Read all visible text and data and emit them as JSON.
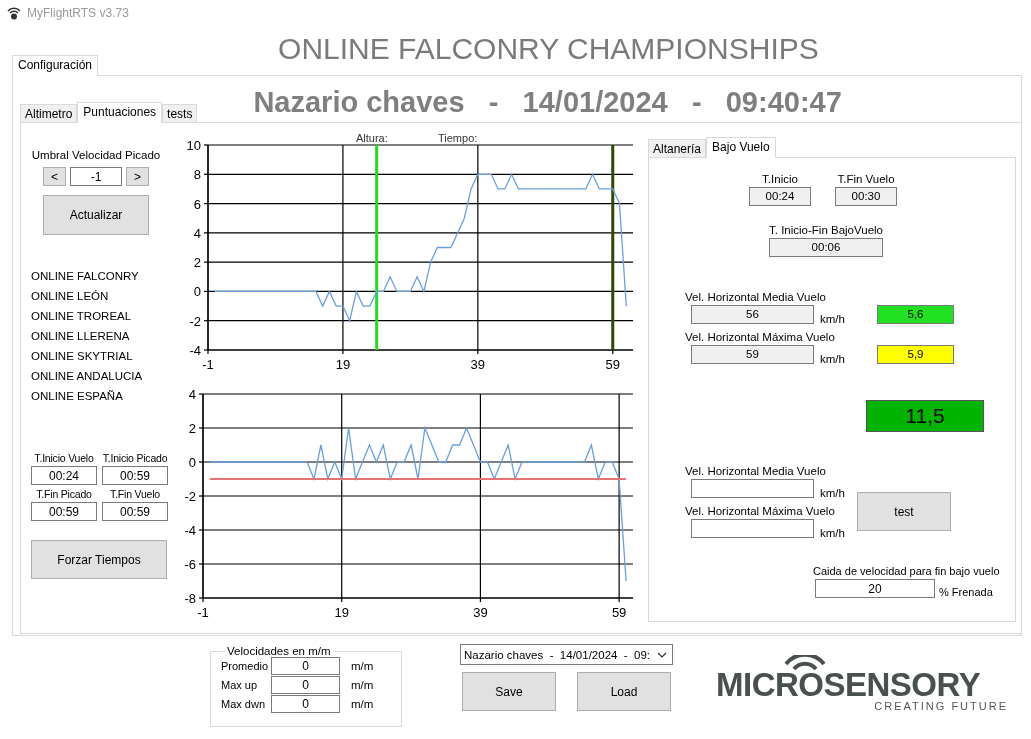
{
  "window": {
    "title": "MyFlightRTS v3.73"
  },
  "headline": "ONLINE FALCONRY CHAMPIONSHIPS",
  "main_tabs": [
    {
      "label": "Configuración",
      "selected": true
    }
  ],
  "session_title": "Nazario chaves   -   14/01/2024   -   09:40:47",
  "sub_tabs": [
    {
      "label": "Altimetro",
      "selected": false
    },
    {
      "label": "Puntuaciones",
      "selected": true
    },
    {
      "label": "tests",
      "selected": false
    }
  ],
  "threshold": {
    "label": "Umbral Velocidad Picado",
    "decrement": "<",
    "value": "-1",
    "increment": ">"
  },
  "update_button": "Actualizar",
  "competitions": [
    "ONLINE FALCONRY",
    "ONLINE LEÓN",
    "ONLINE TROREAL",
    "ONLINE LLERENA",
    "ONLINE SKYTRIAL",
    "ONLINE ANDALUCIA",
    "ONLINE ESPAÑA"
  ],
  "times": [
    {
      "label": "T.Inicio Vuelo",
      "value": "00:24"
    },
    {
      "label": "T.Inicio Picado",
      "value": "00:59"
    },
    {
      "label": "T.Fin Picado",
      "value": "00:59"
    },
    {
      "label": "T.Fin Vuelo",
      "value": "00:59"
    }
  ],
  "force_button": "Forzar Tiempos",
  "altitude_chart": {
    "readouts": [
      "Altura:",
      "Tiempo:"
    ],
    "chart_data": {
      "type": "line",
      "x": [
        0,
        1,
        2,
        3,
        4,
        5,
        6,
        7,
        8,
        9,
        10,
        11,
        12,
        13,
        14,
        15,
        16,
        17,
        18,
        19,
        20,
        21,
        22,
        23,
        24,
        25,
        26,
        27,
        28,
        29,
        30,
        31,
        32,
        33,
        34,
        35,
        36,
        37,
        38,
        39,
        40,
        41,
        42,
        43,
        44,
        45,
        46,
        47,
        48,
        49,
        50,
        51,
        52,
        53,
        54,
        55,
        56,
        57,
        58,
        59,
        60,
        61
      ],
      "series": [
        {
          "color": "#6a9fe0",
          "values": [
            0,
            0,
            0,
            0,
            0,
            0,
            0,
            0,
            0,
            0,
            0,
            0,
            0,
            0,
            0,
            0,
            -1,
            0,
            -1,
            -1,
            -2,
            0,
            -1,
            -1,
            0,
            0,
            1,
            0,
            0,
            0,
            1,
            0,
            2,
            3,
            3,
            3,
            4,
            5,
            7,
            8,
            8,
            8,
            7,
            7,
            8,
            7,
            7,
            7,
            7,
            7,
            7,
            7,
            7,
            7,
            7,
            7,
            8,
            7,
            7,
            7,
            6,
            -1
          ]
        }
      ],
      "xlim": [
        -1,
        62
      ],
      "ylim": [
        -4,
        10
      ],
      "xticks": [
        -1,
        19,
        39,
        59
      ],
      "yticks": [
        -4,
        -2,
        0,
        2,
        4,
        6,
        8,
        10
      ],
      "grid": true,
      "ref_lines": [
        {
          "axis": "x",
          "value": 24,
          "color": "#1ee01e"
        },
        {
          "axis": "x",
          "value": 59,
          "color": "#2e4a00"
        }
      ]
    }
  },
  "speed_chart": {
    "chart_data": {
      "type": "line",
      "x": [
        0,
        1,
        2,
        3,
        4,
        5,
        6,
        7,
        8,
        9,
        10,
        11,
        12,
        13,
        14,
        15,
        16,
        17,
        18,
        19,
        20,
        21,
        22,
        23,
        24,
        25,
        26,
        27,
        28,
        29,
        30,
        31,
        32,
        33,
        34,
        35,
        36,
        37,
        38,
        39,
        40,
        41,
        42,
        43,
        44,
        45,
        46,
        47,
        48,
        49,
        50,
        51,
        52,
        53,
        54,
        55,
        56,
        57,
        58,
        59,
        60
      ],
      "series": [
        {
          "color": "#6a9fe0",
          "values": [
            0,
            0,
            0,
            0,
            0,
            0,
            0,
            0,
            0,
            0,
            0,
            0,
            0,
            0,
            0,
            -1,
            1,
            -1,
            0,
            -1,
            2,
            -1,
            0,
            1,
            0,
            1,
            -1,
            0,
            0,
            1,
            -1,
            2,
            1,
            0,
            0,
            1,
            1,
            2,
            1,
            0,
            0,
            -1,
            0,
            1,
            -1,
            0,
            0,
            0,
            0,
            0,
            0,
            0,
            0,
            0,
            0,
            1,
            -1,
            0,
            0,
            -1,
            -7
          ]
        },
        {
          "color": "#e57373",
          "values": [
            -1,
            -1,
            -1,
            -1,
            -1,
            -1,
            -1,
            -1,
            -1,
            -1,
            -1,
            -1,
            -1,
            -1,
            -1,
            -1,
            -1,
            -1,
            -1,
            -1,
            -1,
            -1,
            -1,
            -1,
            -1,
            -1,
            -1,
            -1,
            -1,
            -1,
            -1,
            -1,
            -1,
            -1,
            -1,
            -1,
            -1,
            -1,
            -1,
            -1,
            -1,
            -1,
            -1,
            -1,
            -1,
            -1,
            -1,
            -1,
            -1,
            -1,
            -1,
            -1,
            -1,
            -1,
            -1,
            -1,
            -1,
            -1,
            -1,
            -1,
            -1
          ]
        }
      ],
      "grid": true,
      "xlim": [
        -1,
        61
      ],
      "ylim": [
        -8,
        4
      ],
      "xticks": [
        -1,
        19,
        39,
        59
      ],
      "yticks": [
        -8,
        -6,
        -4,
        -2,
        0,
        2,
        4
      ]
    }
  },
  "score_tabs": [
    {
      "label": "Altanería",
      "selected": false
    },
    {
      "label": "Bajo Vuelo",
      "selected": true
    }
  ],
  "low_flight": {
    "start": {
      "label": "T.Inicio",
      "value": "00:24"
    },
    "end": {
      "label": "T.Fin Vuelo",
      "value": "00:30"
    },
    "duration": {
      "label": "T. Inicio-Fin BajoVuelo",
      "value": "00:06"
    },
    "speeds": [
      {
        "label": "Vel. Horizontal Media Vuelo",
        "value": "56",
        "unit": "km/h",
        "score": "5,6",
        "color": "#21e021"
      },
      {
        "label": "Vel. Horizontal Máxima Vuelo",
        "value": "59",
        "unit": "km/h",
        "score": "5,9",
        "color": "#ffff00"
      }
    ],
    "total": {
      "value": "11,5",
      "color": "#00b400"
    },
    "test_inputs": [
      {
        "label": "Vel. Horizontal Media Vuelo",
        "unit": "km/h"
      },
      {
        "label": "Vel. Horizontal Máxima Vuelo",
        "unit": "km/h"
      }
    ],
    "test_button": "test",
    "drop": {
      "label": "Caida de velocidad para fin bajo vuelo",
      "value": "20",
      "unit": "% Frenada"
    }
  },
  "velocities": {
    "title": "Velocidades en m/m",
    "rows": [
      {
        "label": "Promedio",
        "value": "0",
        "unit": "m/m"
      },
      {
        "label": "Max up",
        "value": "0",
        "unit": "m/m"
      },
      {
        "label": "Max dwn",
        "value": "0",
        "unit": "m/m"
      }
    ]
  },
  "session_select": {
    "value": "Nazario chaves  -  14/01/2024  -  09:"
  },
  "buttons": [
    "Save",
    "Load"
  ],
  "logo": {
    "name": "MICROSENSORY",
    "tagline": "CREATING FUTURE"
  }
}
